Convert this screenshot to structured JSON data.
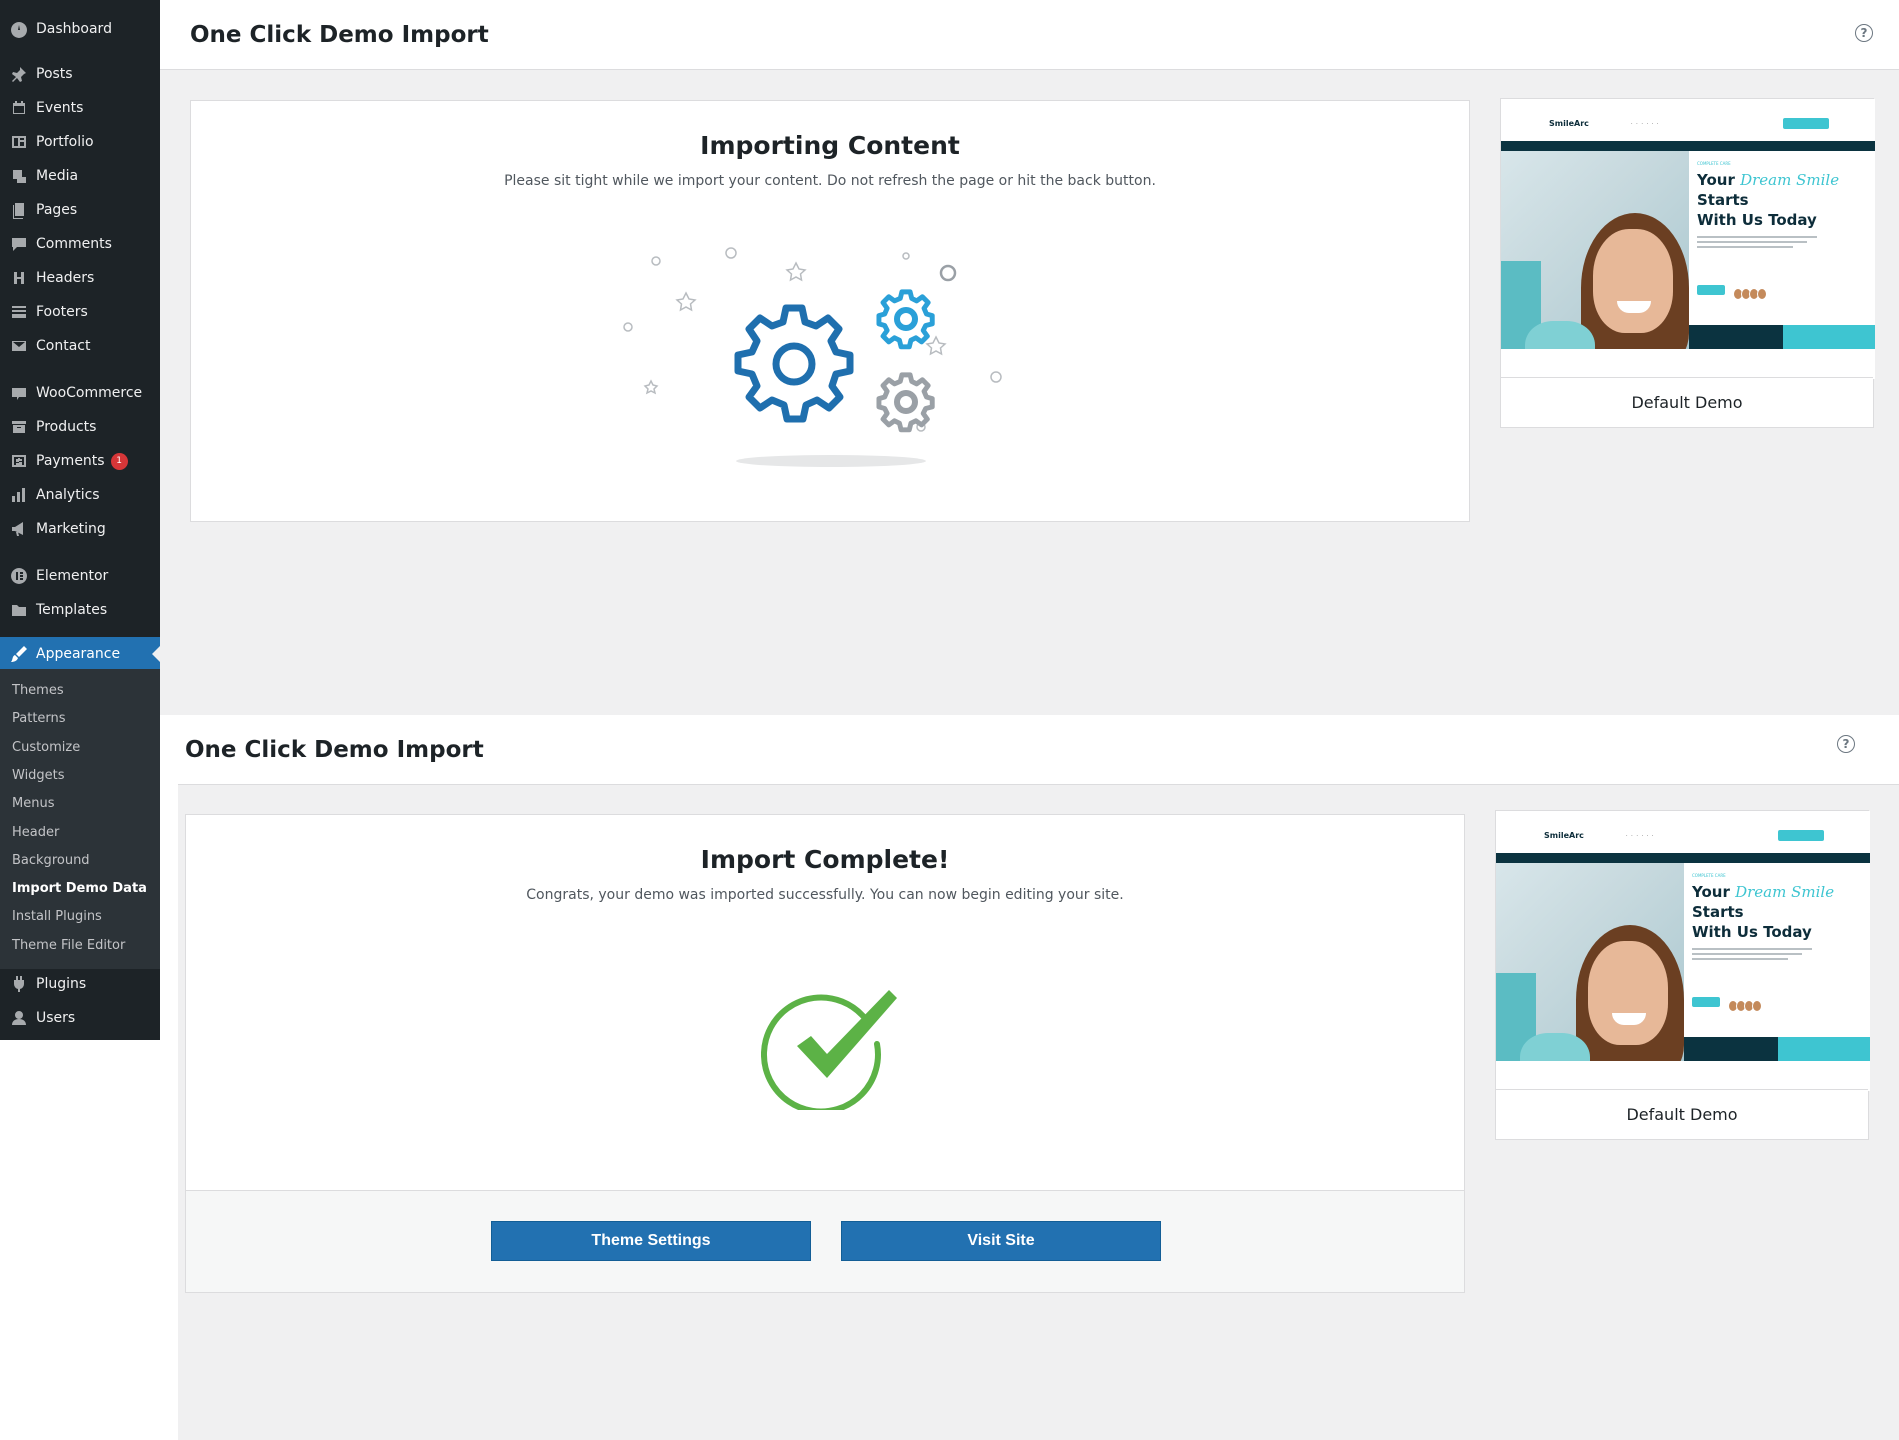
{
  "sidebar": {
    "items": [
      {
        "label": "Dashboard",
        "icon": "dashboard-icon"
      },
      {
        "label": "Posts",
        "icon": "pin-icon"
      },
      {
        "label": "Events",
        "icon": "calendar-icon"
      },
      {
        "label": "Portfolio",
        "icon": "portfolio-icon"
      },
      {
        "label": "Media",
        "icon": "media-icon"
      },
      {
        "label": "Pages",
        "icon": "pages-icon"
      },
      {
        "label": "Comments",
        "icon": "comment-icon"
      },
      {
        "label": "Headers",
        "icon": "header-h-icon"
      },
      {
        "label": "Footers",
        "icon": "footer-icon"
      },
      {
        "label": "Contact",
        "icon": "envelope-icon"
      },
      {
        "label": "WooCommerce",
        "icon": "woo-icon"
      },
      {
        "label": "Products",
        "icon": "archive-icon"
      },
      {
        "label": "Payments",
        "icon": "dollar-icon",
        "badge": "1"
      },
      {
        "label": "Analytics",
        "icon": "bar-chart-icon"
      },
      {
        "label": "Marketing",
        "icon": "megaphone-icon"
      },
      {
        "label": "Elementor",
        "icon": "elementor-icon"
      },
      {
        "label": "Templates",
        "icon": "folder-icon"
      },
      {
        "label": "Appearance",
        "icon": "brush-icon",
        "active": true
      },
      {
        "label": "Plugins",
        "icon": "plug-icon"
      },
      {
        "label": "Users",
        "icon": "user-icon"
      }
    ],
    "submenu": [
      "Themes",
      "Patterns",
      "Customize",
      "Widgets",
      "Menus",
      "Header",
      "Background",
      "Import Demo Data",
      "Install Plugins",
      "Theme File Editor"
    ],
    "current_submenu": "Import Demo Data"
  },
  "top": {
    "page_title": "One Click Demo Import",
    "help_icon": "?",
    "panel_title": "Importing Content",
    "panel_subtitle": "Please sit tight while we import your content. Do not refresh the page or hit the back button.",
    "illustration_icon": "gears-icon",
    "demo_label": "Default Demo"
  },
  "bottom": {
    "page_title": "One Click Demo Import",
    "help_icon": "?",
    "panel_title": "Import Complete!",
    "panel_subtitle": "Congrats, your demo was imported successfully. You can now begin editing your site.",
    "illustration_icon": "checkmark-circle-icon",
    "theme_settings_label": "Theme Settings",
    "visit_site_label": "Visit Site",
    "demo_label": "Default Demo"
  },
  "demo_preview": {
    "logo": "SmileArc",
    "hero_kicker": "COMPLETE CARE",
    "hero_line1_a": "Your",
    "hero_line1_script": "Dream Smile",
    "hero_line1_b": "Starts",
    "hero_line2": "With Us Today"
  },
  "colors": {
    "admin_menu_bg": "#1d2327",
    "submenu_bg": "#2c3338",
    "accent": "#2271b1",
    "gear_blue": "#1f6fae",
    "gear_light_blue": "#2aa0d8",
    "gear_grey": "#9aa0a6",
    "check_green": "#5cb246",
    "badge_red": "#d63638"
  }
}
